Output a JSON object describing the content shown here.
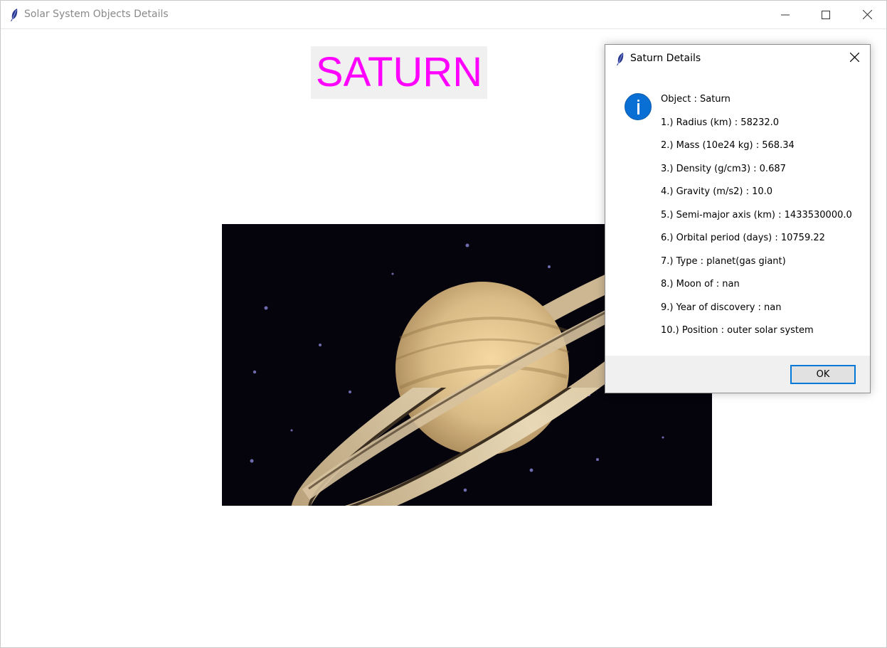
{
  "window": {
    "title": "Solar System Objects Details",
    "controls": {
      "minimize_icon": "minimize-icon",
      "maximize_icon": "maximize-icon",
      "close_icon": "close-icon"
    }
  },
  "main": {
    "heading": "SATURN",
    "heading_color": "#ff00ff",
    "image_alt": "saturn-planet-image"
  },
  "dialog": {
    "title": "Saturn Details",
    "icon": "info-icon",
    "lines": [
      "Object  :  Saturn",
      "1.)  Radius (km)  :  58232.0",
      "2.)  Mass (10e24 kg)  :  568.34",
      "3.)  Density (g/cm3)  :  0.687",
      "4.)  Gravity (m/s2)  :  10.0",
      "5.)  Semi-major axis (km)  :  1433530000.0",
      "6.)  Orbital period (days)  :  10759.22",
      "7.)  Type  :  planet(gas giant)",
      "8.)  Moon of  :  nan",
      "9.)  Year of discovery  :  nan",
      "10.)  Position  :  outer solar system"
    ],
    "ok_label": "OK",
    "accent_color": "#0078d7"
  }
}
